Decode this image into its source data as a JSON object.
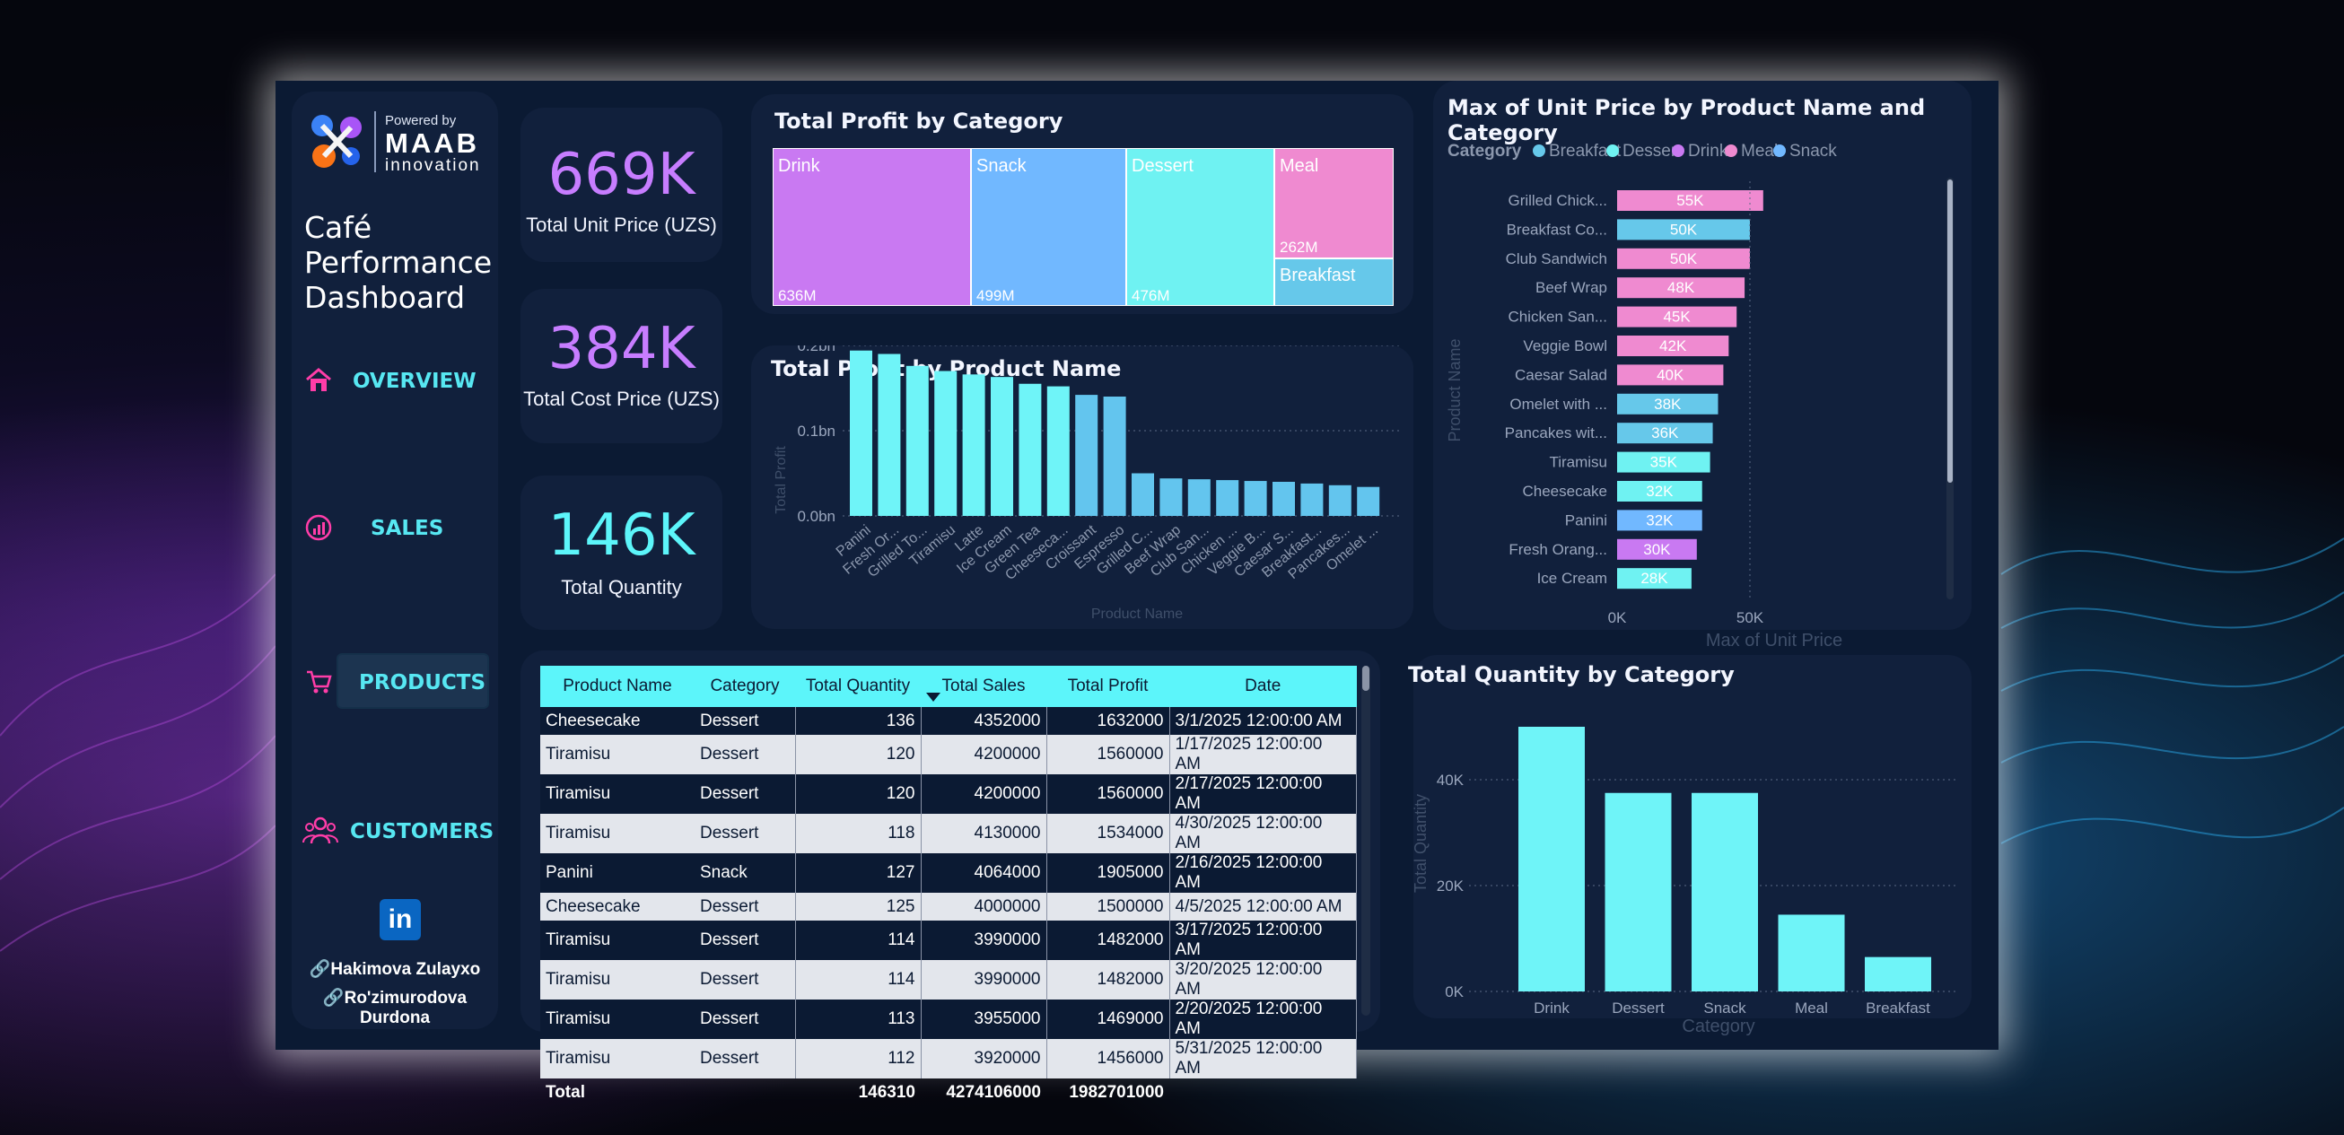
{
  "dashboard": {
    "title_lines": [
      "Café",
      "Performance",
      "Dashboard"
    ],
    "logo_powered": "Powered by",
    "logo_name": "MAAB",
    "logo_sub": "innovation"
  },
  "nav": {
    "items": [
      {
        "label": "OVERVIEW",
        "icon": "home-icon"
      },
      {
        "label": "SALES",
        "icon": "sales-chart-icon"
      },
      {
        "label": "PRODUCTS",
        "icon": "cart-icon",
        "active": true
      },
      {
        "label": "CUSTOMERS",
        "icon": "users-icon"
      }
    ]
  },
  "authors": [
    "Hakimova Zulayxo",
    "Ro'zimurodova Durdona"
  ],
  "kpis": [
    {
      "value": "669K",
      "label": "Total Unit Price (UZS)",
      "color": "#c77dff"
    },
    {
      "value": "384K",
      "label": "Total Cost Price (UZS)",
      "color": "#c77dff"
    },
    {
      "value": "146K",
      "label": "Total Quantity",
      "color": "#5cf5fa"
    }
  ],
  "colors": {
    "drink": "#c979f2",
    "snack": "#71b8ff",
    "dessert": "#6ff2f2",
    "meal": "#ef8ad0",
    "breakfast": "#66c8ea",
    "cyan": "#6ff4f8",
    "bar_blue": "#63c5ee"
  },
  "treemap": {
    "title": "Total Profit by Category",
    "tiles": [
      {
        "name": "Drink",
        "value_label": "636M"
      },
      {
        "name": "Snack",
        "value_label": "499M"
      },
      {
        "name": "Dessert",
        "value_label": "476M"
      },
      {
        "name": "Meal",
        "value_label": "262M"
      },
      {
        "name": "Breakfast",
        "value_label": ""
      }
    ]
  },
  "product_profit": {
    "title": "Total Profit by Product Name",
    "ylabel": "Total Profit",
    "xlabel": "Product Name",
    "ticks": [
      "0.2bn",
      "0.1bn",
      "0.0bn"
    ],
    "bars": [
      {
        "label": "Panini",
        "value": 0.194,
        "hi": true
      },
      {
        "label": "Fresh Or...",
        "value": 0.19,
        "hi": true
      },
      {
        "label": "Grilled To...",
        "value": 0.176,
        "hi": true
      },
      {
        "label": "Tiramisu",
        "value": 0.17,
        "hi": true
      },
      {
        "label": "Latte",
        "value": 0.166,
        "hi": true
      },
      {
        "label": "Ice Cream",
        "value": 0.163,
        "hi": true
      },
      {
        "label": "Green Tea",
        "value": 0.155,
        "hi": true
      },
      {
        "label": "Cheeseca...",
        "value": 0.152,
        "hi": true
      },
      {
        "label": "Croissant",
        "value": 0.142,
        "hi": false
      },
      {
        "label": "Espresso",
        "value": 0.14,
        "hi": false
      },
      {
        "label": "Grilled C...",
        "value": 0.05,
        "hi": false
      },
      {
        "label": "Beef Wrap",
        "value": 0.044,
        "hi": false
      },
      {
        "label": "Club San...",
        "value": 0.043,
        "hi": false
      },
      {
        "label": "Chicken ...",
        "value": 0.042,
        "hi": false
      },
      {
        "label": "Veggie B...",
        "value": 0.041,
        "hi": false
      },
      {
        "label": "Caesar S...",
        "value": 0.04,
        "hi": false
      },
      {
        "label": "Breakfast...",
        "value": 0.038,
        "hi": false
      },
      {
        "label": "Pancakes...",
        "value": 0.036,
        "hi": false
      },
      {
        "label": "Omelet ...",
        "value": 0.034,
        "hi": false
      }
    ]
  },
  "unit_price": {
    "title": "Max of Unit Price by Product Name and Category",
    "legend_title": "Category",
    "legend": [
      {
        "name": "Breakfast",
        "key": "breakfast"
      },
      {
        "name": "Dessert",
        "key": "dessert"
      },
      {
        "name": "Drink",
        "key": "drink"
      },
      {
        "name": "Meal",
        "key": "meal"
      },
      {
        "name": "Snack",
        "key": "snack"
      }
    ],
    "ylabel": "Product Name",
    "xlabel": "Max of Unit Price",
    "xticks": [
      "0K",
      "50K"
    ],
    "bars": [
      {
        "label": "Grilled Chick...",
        "value": 55,
        "cat": "meal",
        "text": "55K"
      },
      {
        "label": "Breakfast Co...",
        "value": 50,
        "cat": "breakfast",
        "text": "50K"
      },
      {
        "label": "Club Sandwich",
        "value": 50,
        "cat": "meal",
        "text": "50K"
      },
      {
        "label": "Beef Wrap",
        "value": 48,
        "cat": "meal",
        "text": "48K"
      },
      {
        "label": "Chicken San...",
        "value": 45,
        "cat": "meal",
        "text": "45K"
      },
      {
        "label": "Veggie Bowl",
        "value": 42,
        "cat": "meal",
        "text": "42K"
      },
      {
        "label": "Caesar Salad",
        "value": 40,
        "cat": "meal",
        "text": "40K"
      },
      {
        "label": "Omelet with ...",
        "value": 38,
        "cat": "breakfast",
        "text": "38K"
      },
      {
        "label": "Pancakes wit...",
        "value": 36,
        "cat": "breakfast",
        "text": "36K"
      },
      {
        "label": "Tiramisu",
        "value": 35,
        "cat": "dessert",
        "text": "35K"
      },
      {
        "label": "Cheesecake",
        "value": 32,
        "cat": "dessert",
        "text": "32K"
      },
      {
        "label": "Panini",
        "value": 32,
        "cat": "snack",
        "text": "32K"
      },
      {
        "label": "Fresh Orang...",
        "value": 30,
        "cat": "drink",
        "text": "30K"
      },
      {
        "label": "Ice Cream",
        "value": 28,
        "cat": "dessert",
        "text": "28K"
      }
    ]
  },
  "table": {
    "columns": [
      "Product Name",
      "Category",
      "Total Quantity",
      "Total Sales",
      "Total Profit",
      "Date"
    ],
    "rows": [
      [
        "Cheesecake",
        "Dessert",
        "136",
        "4352000",
        "1632000",
        "3/1/2025 12:00:00 AM"
      ],
      [
        "Tiramisu",
        "Dessert",
        "120",
        "4200000",
        "1560000",
        "1/17/2025 12:00:00 AM"
      ],
      [
        "Tiramisu",
        "Dessert",
        "120",
        "4200000",
        "1560000",
        "2/17/2025 12:00:00 AM"
      ],
      [
        "Tiramisu",
        "Dessert",
        "118",
        "4130000",
        "1534000",
        "4/30/2025 12:00:00 AM"
      ],
      [
        "Panini",
        "Snack",
        "127",
        "4064000",
        "1905000",
        "2/16/2025 12:00:00 AM"
      ],
      [
        "Cheesecake",
        "Dessert",
        "125",
        "4000000",
        "1500000",
        "4/5/2025 12:00:00 AM"
      ],
      [
        "Tiramisu",
        "Dessert",
        "114",
        "3990000",
        "1482000",
        "3/17/2025 12:00:00 AM"
      ],
      [
        "Tiramisu",
        "Dessert",
        "114",
        "3990000",
        "1482000",
        "3/20/2025 12:00:00 AM"
      ],
      [
        "Tiramisu",
        "Dessert",
        "113",
        "3955000",
        "1469000",
        "2/20/2025 12:00:00 AM"
      ],
      [
        "Tiramisu",
        "Dessert",
        "112",
        "3920000",
        "1456000",
        "5/31/2025 12:00:00 AM"
      ]
    ],
    "total_label": "Total",
    "totals": [
      "146310",
      "4274106000",
      "1982701000"
    ]
  },
  "qty_category": {
    "title": "Total Quantity by Category",
    "ylabel": "Total Quantity",
    "xlabel": "Category",
    "yticks": [
      "40K",
      "20K",
      "0K"
    ]
  },
  "chart_data": [
    {
      "type": "treemap",
      "title": "Total Profit by Category",
      "categories": [
        "Drink",
        "Snack",
        "Dessert",
        "Meal",
        "Breakfast"
      ],
      "values": [
        636,
        499,
        476,
        262,
        110
      ],
      "unit": "M"
    },
    {
      "type": "bar",
      "title": "Total Profit by Product Name",
      "categories": [
        "Panini",
        "Fresh Or...",
        "Grilled To...",
        "Tiramisu",
        "Latte",
        "Ice Cream",
        "Green Tea",
        "Cheeseca...",
        "Croissant",
        "Espresso",
        "Grilled C...",
        "Beef Wrap",
        "Club San...",
        "Chicken ...",
        "Veggie B...",
        "Caesar S...",
        "Breakfast...",
        "Pancakes...",
        "Omelet ..."
      ],
      "values": [
        0.194,
        0.19,
        0.176,
        0.17,
        0.166,
        0.163,
        0.155,
        0.152,
        0.142,
        0.14,
        0.05,
        0.044,
        0.043,
        0.042,
        0.041,
        0.04,
        0.038,
        0.036,
        0.034
      ],
      "xlabel": "Product Name",
      "ylabel": "Total Profit",
      "ylim": [
        0,
        0.2
      ],
      "unit": "bn"
    },
    {
      "type": "bar",
      "title": "Max of Unit Price by Product Name and Category",
      "categories": [
        "Grilled Chick...",
        "Breakfast Co...",
        "Club Sandwich",
        "Beef Wrap",
        "Chicken San...",
        "Veggie Bowl",
        "Caesar Salad",
        "Omelet with ...",
        "Pancakes wit...",
        "Tiramisu",
        "Cheesecake",
        "Panini",
        "Fresh Orang...",
        "Ice Cream"
      ],
      "values": [
        55,
        50,
        50,
        48,
        45,
        42,
        40,
        38,
        36,
        35,
        32,
        32,
        30,
        28
      ],
      "xlabel": "Max of Unit Price",
      "ylabel": "Product Name",
      "xlim": [
        0,
        60
      ],
      "unit": "K"
    },
    {
      "type": "bar",
      "title": "Total Quantity by Category",
      "categories": [
        "Drink",
        "Dessert",
        "Snack",
        "Meal",
        "Breakfast"
      ],
      "values": [
        50000,
        37500,
        37500,
        14500,
        6500
      ],
      "xlabel": "Category",
      "ylabel": "Total Quantity",
      "ylim": [
        0,
        50000
      ]
    }
  ]
}
